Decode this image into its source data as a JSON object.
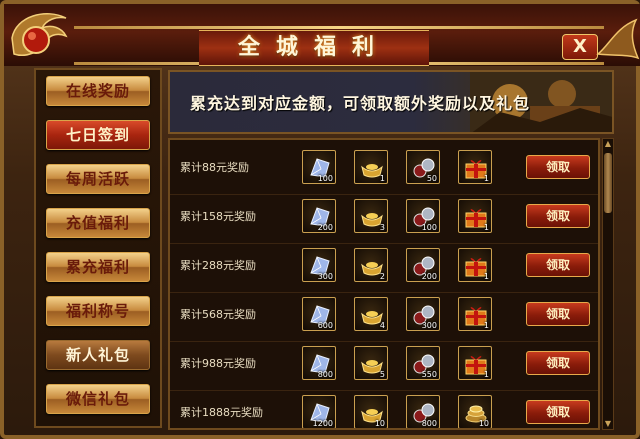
{
  "window": {
    "title": "全城福利",
    "close_label": "X"
  },
  "sidebar": {
    "items": [
      {
        "label": "在线奖励",
        "state": "normal"
      },
      {
        "label": "七日签到",
        "state": "active"
      },
      {
        "label": "每周活跃",
        "state": "normal"
      },
      {
        "label": "充值福利",
        "state": "normal"
      },
      {
        "label": "累充福利",
        "state": "normal"
      },
      {
        "label": "福利称号",
        "state": "normal"
      },
      {
        "label": "新人礼包",
        "state": "dark"
      },
      {
        "label": "微信礼包",
        "state": "normal"
      }
    ]
  },
  "banner": {
    "text": "累充达到对应金额，可领取额外奖励以及礼包"
  },
  "rewards": {
    "claim_label": "领取",
    "rows": [
      {
        "label": "累计88元奖励",
        "items": [
          {
            "icon": "crystal-icon",
            "qty": "100"
          },
          {
            "icon": "gold-ingot-icon",
            "qty": "1"
          },
          {
            "icon": "potion-icon",
            "qty": "50"
          },
          {
            "icon": "gift-box-icon",
            "qty": "1"
          }
        ]
      },
      {
        "label": "累计158元奖励",
        "items": [
          {
            "icon": "crystal-icon",
            "qty": "200"
          },
          {
            "icon": "gold-ingot-icon",
            "qty": "3"
          },
          {
            "icon": "potion-icon",
            "qty": "100"
          },
          {
            "icon": "gift-box-icon",
            "qty": "1"
          }
        ]
      },
      {
        "label": "累计288元奖励",
        "items": [
          {
            "icon": "crystal-icon",
            "qty": "300"
          },
          {
            "icon": "gold-ingot-icon",
            "qty": "2"
          },
          {
            "icon": "potion-icon",
            "qty": "200"
          },
          {
            "icon": "gift-box-icon",
            "qty": "1"
          }
        ]
      },
      {
        "label": "累计568元奖励",
        "items": [
          {
            "icon": "crystal-icon",
            "qty": "600"
          },
          {
            "icon": "gold-ingot-icon",
            "qty": "4"
          },
          {
            "icon": "potion-icon",
            "qty": "300"
          },
          {
            "icon": "gift-box-icon",
            "qty": "1"
          }
        ]
      },
      {
        "label": "累计988元奖励",
        "items": [
          {
            "icon": "crystal-icon",
            "qty": "800"
          },
          {
            "icon": "gold-ingot-icon",
            "qty": "5"
          },
          {
            "icon": "potion-icon",
            "qty": "550"
          },
          {
            "icon": "gift-box-icon",
            "qty": "1"
          }
        ]
      },
      {
        "label": "累计1888元奖励",
        "items": [
          {
            "icon": "crystal-icon",
            "qty": "1200"
          },
          {
            "icon": "gold-ingot-icon",
            "qty": "10"
          },
          {
            "icon": "potion-icon",
            "qty": "800"
          },
          {
            "icon": "coin-pile-icon",
            "qty": "10"
          }
        ]
      }
    ]
  },
  "colors": {
    "accent_gold": "#e6b45a",
    "claim_red": "#a8250f",
    "panel_dark": "#1d1007"
  }
}
